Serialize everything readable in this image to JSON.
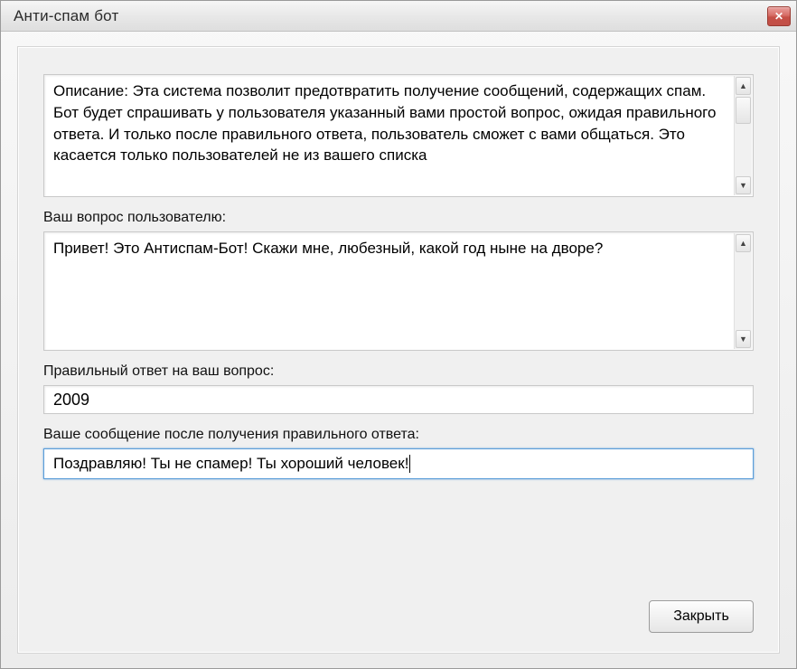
{
  "window": {
    "title": "Анти-спам бот"
  },
  "description": {
    "text": "Описание: Эта система позволит предотвратить получение сообщений, содержащих спам. Бот будет спрашивать у пользователя указанный вами простой вопрос, ожидая правильного ответа. И только после правильного ответа, пользователь сможет с вами общаться. Это касается только пользователей не из вашего списка"
  },
  "question": {
    "label": "Ваш вопрос пользователю:",
    "text": "Привет! Это Антиспам-Бот! Скажи мне, любезный, какой год ныне на дворе?"
  },
  "answer": {
    "label": "Правильный ответ на ваш вопрос:",
    "value": "2009"
  },
  "success_message": {
    "label": "Ваше сообщение после получения правильного ответа:",
    "value": "Поздравляю! Ты не спамер! Ты хороший человек!"
  },
  "buttons": {
    "close": "Закрыть"
  }
}
